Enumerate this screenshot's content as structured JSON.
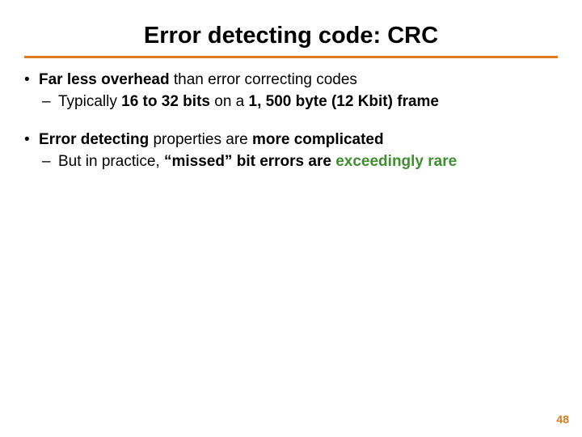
{
  "title": "Error detecting code: CRC",
  "bullets": {
    "b1": {
      "lead": "Far less overhead",
      "rest": " than error correcting codes",
      "sub1_a": "Typically ",
      "sub1_b": "16 to 32 bits",
      "sub1_c": " on a ",
      "sub1_d": "1, 500 byte (12 Kbit) frame"
    },
    "b2": {
      "lead": "Error detecting",
      "mid": " properties are ",
      "tail": "more complicated",
      "sub1_a": "But in practice, ",
      "sub1_b": "“missed” bit errors are ",
      "sub1_c": "exceedingly rare"
    }
  },
  "page_number": "48"
}
